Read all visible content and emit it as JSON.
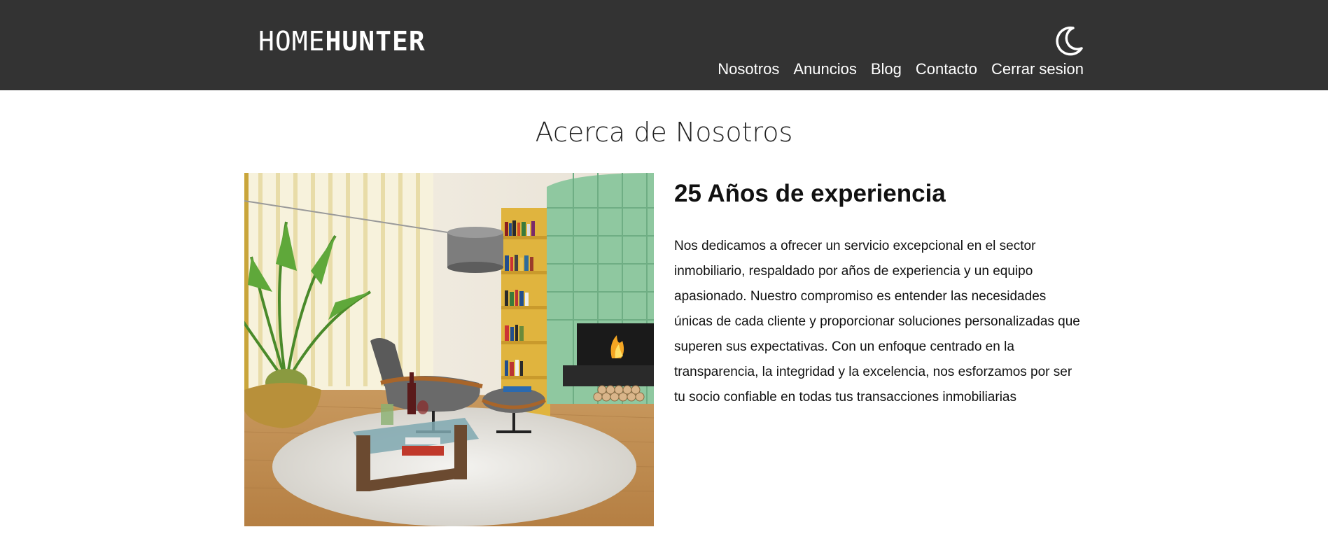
{
  "header": {
    "logo_light": "HOME",
    "logo_bold": "HUNTER",
    "theme_icon": "moon-icon",
    "nav": [
      {
        "label": "Nosotros"
      },
      {
        "label": "Anuncios"
      },
      {
        "label": "Blog"
      },
      {
        "label": "Contacto"
      },
      {
        "label": "Cerrar sesion"
      }
    ],
    "background": "#333333"
  },
  "main": {
    "title": "Acerca de Nosotros",
    "image": "living-room-photo",
    "heading": "25 Años de experiencia",
    "body": "Nos dedicamos a ofrecer un servicio excepcional en el sector inmobiliario, respaldado por años de experiencia y un equipo apasionado. Nuestro compromiso es entender las necesidades únicas de cada cliente y proporcionar soluciones personalizadas que superen sus expectativas. Con un enfoque centrado en la transparencia, la integridad y la excelencia, nos esforzamos por ser tu socio confiable en todas tus transacciones inmobiliarias"
  }
}
